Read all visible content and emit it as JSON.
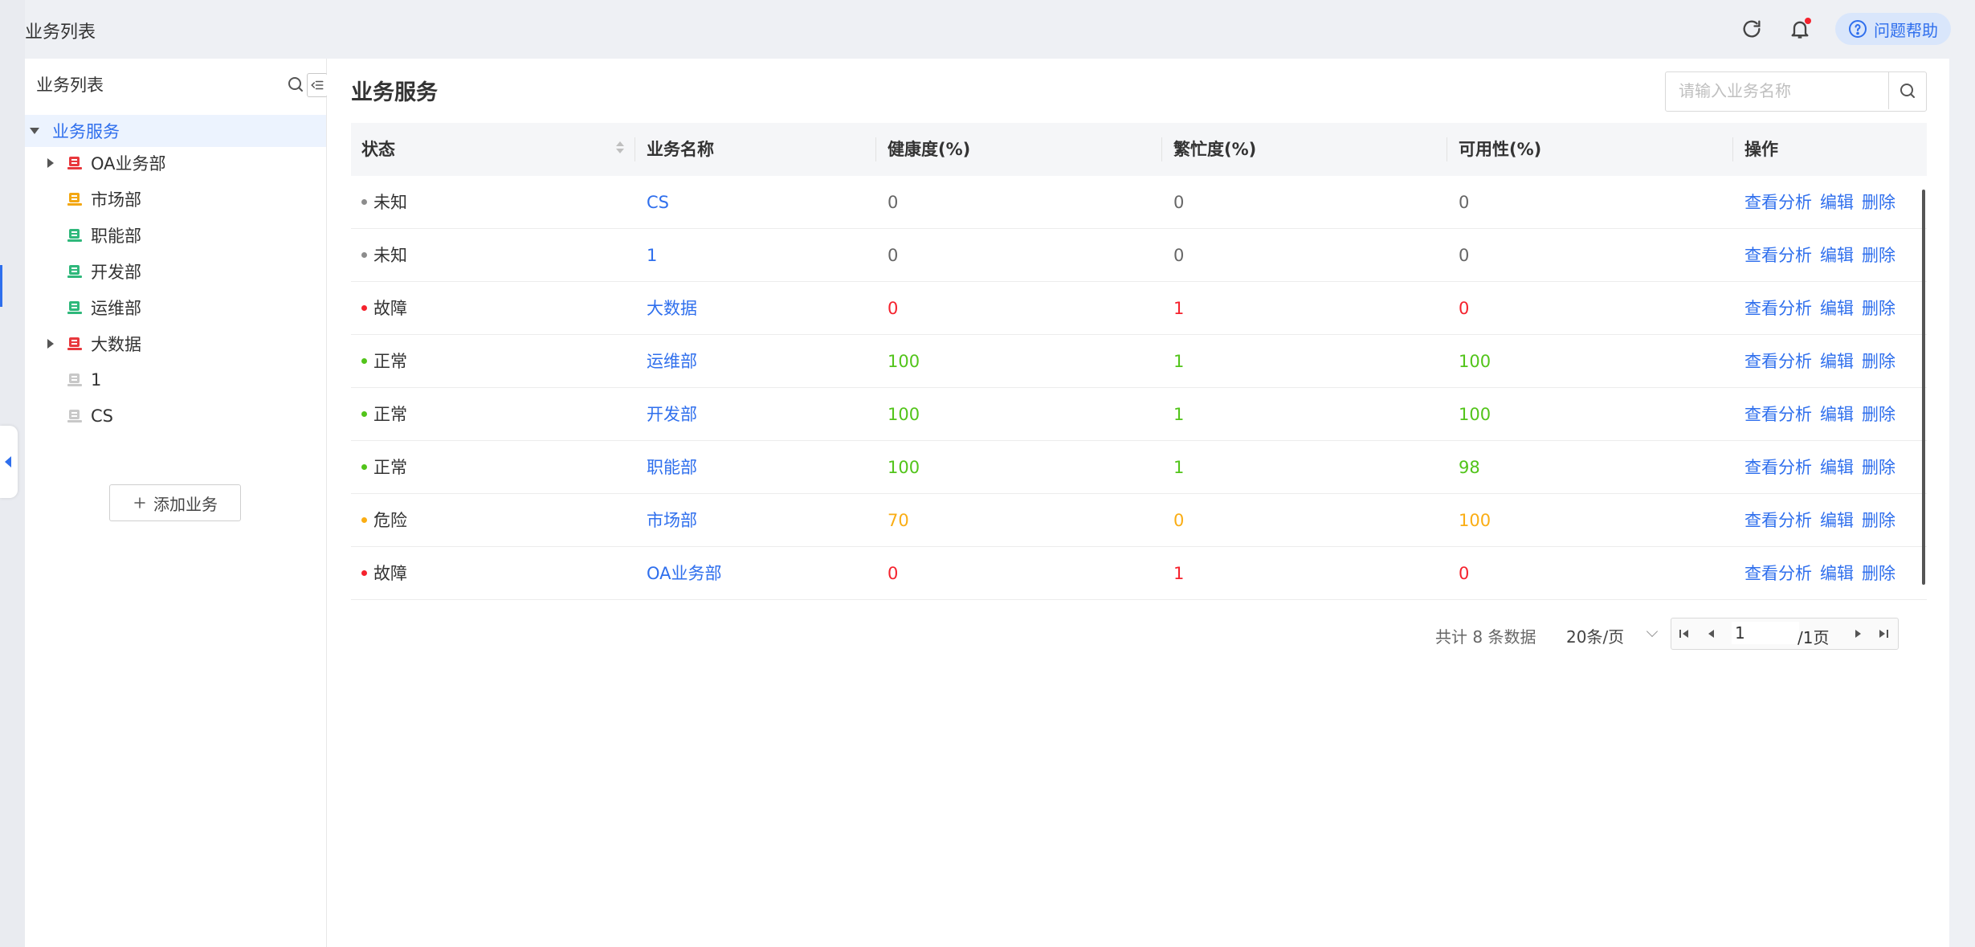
{
  "topbar": {
    "title": "业务列表",
    "help_label": "问题帮助"
  },
  "sidebar": {
    "title": "业务列表",
    "root_label": "业务服务",
    "items": [
      {
        "label": "OA业务部",
        "expandable": true,
        "icon_color": "#e8383d"
      },
      {
        "label": "市场部",
        "expandable": false,
        "icon_color": "#f3a712"
      },
      {
        "label": "职能部",
        "expandable": false,
        "icon_color": "#2fb87b"
      },
      {
        "label": "开发部",
        "expandable": false,
        "icon_color": "#2fb87b"
      },
      {
        "label": "运维部",
        "expandable": false,
        "icon_color": "#2fb87b"
      },
      {
        "label": "大数据",
        "expandable": true,
        "icon_color": "#e8383d"
      },
      {
        "label": "1",
        "expandable": false,
        "icon_color": "#c8c8c8"
      },
      {
        "label": "CS",
        "expandable": false,
        "icon_color": "#c8c8c8"
      }
    ],
    "add_label": "添加业务"
  },
  "main": {
    "title": "业务服务",
    "search_placeholder": "请输入业务名称",
    "columns": [
      "状态",
      "业务名称",
      "健康度(%)",
      "繁忙度(%)",
      "可用性(%)",
      "操作"
    ],
    "actions": [
      "查看分析",
      "编辑",
      "删除"
    ],
    "rows": [
      {
        "status": "未知",
        "status_color": "#8c8c8c",
        "name": "CS",
        "health": "0",
        "busy": "0",
        "avail": "0",
        "value_color": "#666666"
      },
      {
        "status": "未知",
        "status_color": "#8c8c8c",
        "name": "1",
        "health": "0",
        "busy": "0",
        "avail": "0",
        "value_color": "#666666"
      },
      {
        "status": "故障",
        "status_color": "#f5222d",
        "name": "大数据",
        "health": "0",
        "busy": "1",
        "avail": "0",
        "value_color": "#f5222d"
      },
      {
        "status": "正常",
        "status_color": "#52c41a",
        "name": "运维部",
        "health": "100",
        "busy": "1",
        "avail": "100",
        "value_color": "#52c41a"
      },
      {
        "status": "正常",
        "status_color": "#52c41a",
        "name": "开发部",
        "health": "100",
        "busy": "1",
        "avail": "100",
        "value_color": "#52c41a"
      },
      {
        "status": "正常",
        "status_color": "#52c41a",
        "name": "职能部",
        "health": "100",
        "busy": "1",
        "avail": "98",
        "value_color": "#52c41a"
      },
      {
        "status": "危险",
        "status_color": "#faad14",
        "name": "市场部",
        "health": "70",
        "busy": "0",
        "avail": "100",
        "value_color": "#faad14"
      },
      {
        "status": "故障",
        "status_color": "#f5222d",
        "name": "OA业务部",
        "health": "0",
        "busy": "1",
        "avail": "0",
        "value_color": "#f5222d"
      }
    ],
    "pager": {
      "total": "共计 8 条数据",
      "page_size": "20条/页",
      "current_page": "1",
      "of_pages": "/1页"
    }
  },
  "colors": {
    "accent": "#2f6fed"
  }
}
